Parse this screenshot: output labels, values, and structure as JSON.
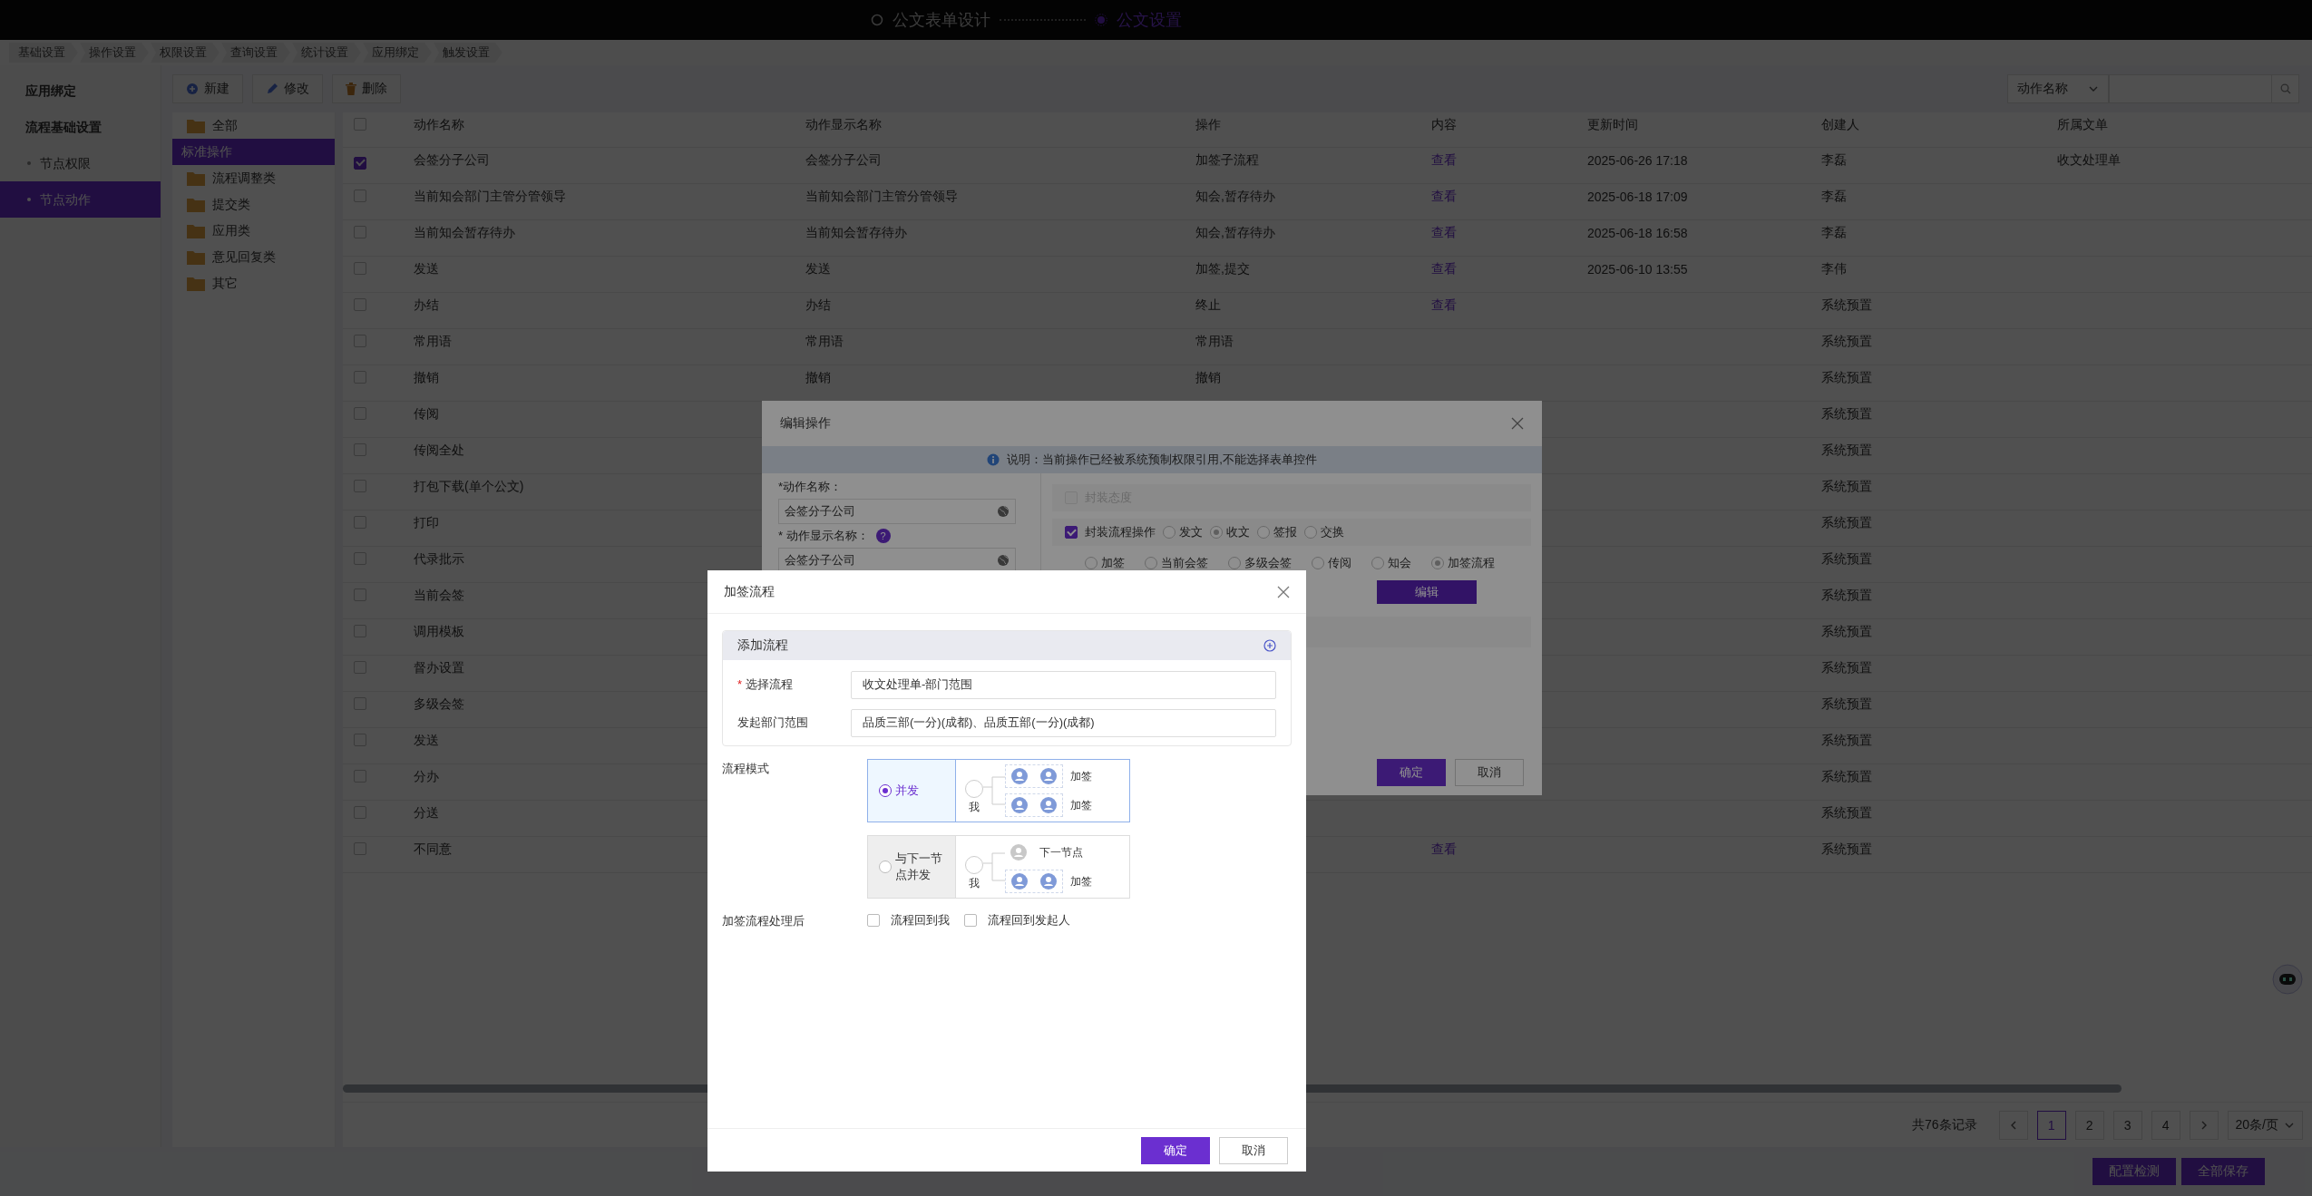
{
  "top_bar": {
    "steps": [
      {
        "label": "公文表单设计",
        "selected": false
      },
      {
        "label": "公文设置",
        "selected": true
      }
    ]
  },
  "tabs": [
    {
      "label": "基础设置"
    },
    {
      "label": "操作设置"
    },
    {
      "label": "权限设置"
    },
    {
      "label": "查询设置"
    },
    {
      "label": "统计设置"
    },
    {
      "label": "应用绑定"
    },
    {
      "label": "触发设置"
    }
  ],
  "sidebar": {
    "items": [
      {
        "label": "应用绑定",
        "selected": false
      },
      {
        "label": "流程基础设置",
        "selected": false,
        "children": [
          {
            "label": "节点权限",
            "selected": false
          },
          {
            "label": "节点动作",
            "selected": true
          }
        ]
      }
    ]
  },
  "toolbar": {
    "buttons": [
      {
        "label": "新建",
        "kind": "new"
      },
      {
        "label": "修改",
        "kind": "edit"
      },
      {
        "label": "删除",
        "kind": "delete"
      }
    ],
    "filter": {
      "value": "动作名称"
    }
  },
  "category_tree": [
    {
      "label": "全部",
      "kind": "folder",
      "selected": false
    },
    {
      "label": "标准操作",
      "kind": "plain",
      "selected": true
    },
    {
      "label": "流程调整类",
      "kind": "folder",
      "selected": false
    },
    {
      "label": "提交类",
      "kind": "folder",
      "selected": false
    },
    {
      "label": "应用类",
      "kind": "folder",
      "selected": false
    },
    {
      "label": "意见回复类",
      "kind": "folder",
      "selected": false
    },
    {
      "label": "其它",
      "kind": "folder",
      "selected": false
    }
  ],
  "table": {
    "columns": [
      "动作名称",
      "动作显示名称",
      "操作",
      "内容",
      "更新时间",
      "创建人",
      "所属文单"
    ],
    "all_checked": false,
    "rows": [
      {
        "checked": true,
        "name": "会签分子公司",
        "display_name": "会签分子公司",
        "operation": "加签子流程",
        "content": "查看",
        "updated": "2025-06-26 17:18",
        "creator": "李磊",
        "document": "收文处理单"
      },
      {
        "checked": false,
        "name": "当前知会部门主管分管领导",
        "display_name": "当前知会部门主管分管领导",
        "operation": "知会,暂存待办",
        "content": "查看",
        "updated": "2025-06-18 17:09",
        "creator": "李磊"
      },
      {
        "checked": false,
        "name": "当前知会暂存待办",
        "display_name": "当前知会暂存待办",
        "operation": "知会,暂存待办",
        "content": "查看",
        "updated": "2025-06-18 16:58",
        "creator": "李磊"
      },
      {
        "checked": false,
        "name": "发送",
        "display_name": "发送",
        "operation": "加签,提交",
        "content": "查看",
        "updated": "2025-06-10 13:55",
        "creator": "李伟"
      },
      {
        "checked": false,
        "name": "办结",
        "display_name": "办结",
        "operation": "终止",
        "content": "查看",
        "creator": "系统预置"
      },
      {
        "checked": false,
        "name": "常用语",
        "display_name": "常用语",
        "operation": "常用语",
        "creator": "系统预置"
      },
      {
        "checked": false,
        "name": "撤销",
        "display_name": "撤销",
        "operation": "撤销",
        "creator": "系统预置"
      },
      {
        "checked": false,
        "name": "传阅",
        "creator": "系统预置"
      },
      {
        "checked": false,
        "name": "传阅全处",
        "creator": "系统预置"
      },
      {
        "checked": false,
        "name": "打包下载(单个公文)",
        "creator": "系统预置"
      },
      {
        "checked": false,
        "name": "打印",
        "creator": "系统预置"
      },
      {
        "checked": false,
        "name": "代录批示",
        "creator": "系统预置"
      },
      {
        "checked": false,
        "name": "当前会签",
        "creator": "系统预置"
      },
      {
        "checked": false,
        "name": "调用模板",
        "creator": "系统预置"
      },
      {
        "checked": false,
        "name": "督办设置",
        "creator": "系统预置"
      },
      {
        "checked": false,
        "name": "多级会签",
        "creator": "系统预置"
      },
      {
        "checked": false,
        "name": "发送",
        "creator": "系统预置"
      },
      {
        "checked": false,
        "name": "分办",
        "creator": "系统预置"
      },
      {
        "checked": false,
        "name": "分送",
        "creator": "系统预置"
      },
      {
        "checked": false,
        "name": "不同意",
        "content": "查看",
        "creator": "系统预置"
      }
    ]
  },
  "pagination": {
    "total": "共76条记录",
    "pages": [
      {
        "label": "1",
        "selected": true
      },
      {
        "label": "2",
        "selected": false
      },
      {
        "label": "3",
        "selected": false
      },
      {
        "label": "4",
        "selected": false
      }
    ],
    "page_size": "20条/页"
  },
  "footer_buttons": [
    {
      "label": "配置检测"
    },
    {
      "label": "全部保存"
    }
  ],
  "edit_dialog": {
    "title": "编辑操作",
    "notice": "说明：当前操作已经被系统预制权限引用,不能选择表单控件",
    "fields": [
      {
        "label": "*动作名称：",
        "value": "会签分子公司"
      },
      {
        "label": "* 动作显示名称：",
        "value": "会签分子公司",
        "help": "?"
      }
    ],
    "options": [
      {
        "label": "封装态度",
        "checked": false,
        "disabled": true
      },
      {
        "label": "封装流程操作",
        "checked": true,
        "disabled": false,
        "radios": [
          {
            "label": "发文",
            "selected": false
          },
          {
            "label": "收文",
            "selected": true
          },
          {
            "label": "签报",
            "selected": false
          },
          {
            "label": "交换",
            "selected": false
          }
        ]
      }
    ],
    "action_radios": [
      {
        "label": "加签",
        "selected": false
      },
      {
        "label": "当前会签",
        "selected": false
      },
      {
        "label": "多级会签",
        "selected": false
      },
      {
        "label": "传阅",
        "selected": false
      },
      {
        "label": "知会",
        "selected": false
      },
      {
        "label": "加签流程",
        "selected": true
      }
    ],
    "edit_button": "编辑",
    "buttons": [
      {
        "label": "确定",
        "kind": "primary"
      },
      {
        "label": "取消",
        "kind": "default"
      }
    ]
  },
  "add_dialog": {
    "title": "加签流程",
    "section": {
      "title": "添加流程",
      "fields": [
        {
          "label": "选择流程",
          "mark": "*",
          "value": "收文处理单-部门范围"
        },
        {
          "label": "发起部门范围",
          "value": "品质三部(一分)(成都)、品质五部(一分)(成都)"
        }
      ]
    },
    "mode": {
      "label": "流程模式",
      "options": [
        {
          "label": "并发",
          "selected": true,
          "me": "我",
          "branches": [
            {
              "label": "加签",
              "kind": "countersign"
            },
            {
              "label": "加签",
              "kind": "countersign"
            }
          ]
        },
        {
          "label": "与下一节点并发",
          "selected": false,
          "me": "我",
          "branches": [
            {
              "label": "下一节点",
              "kind": "next"
            },
            {
              "label": "加签",
              "kind": "countersign"
            }
          ]
        }
      ]
    },
    "after": {
      "label": "加签流程处理后",
      "options": [
        {
          "label": "流程回到我",
          "checked": false
        },
        {
          "label": "流程回到发起人",
          "checked": false
        }
      ]
    },
    "buttons": [
      {
        "label": "确定",
        "kind": "primary"
      },
      {
        "label": "取消",
        "kind": "default"
      }
    ]
  }
}
